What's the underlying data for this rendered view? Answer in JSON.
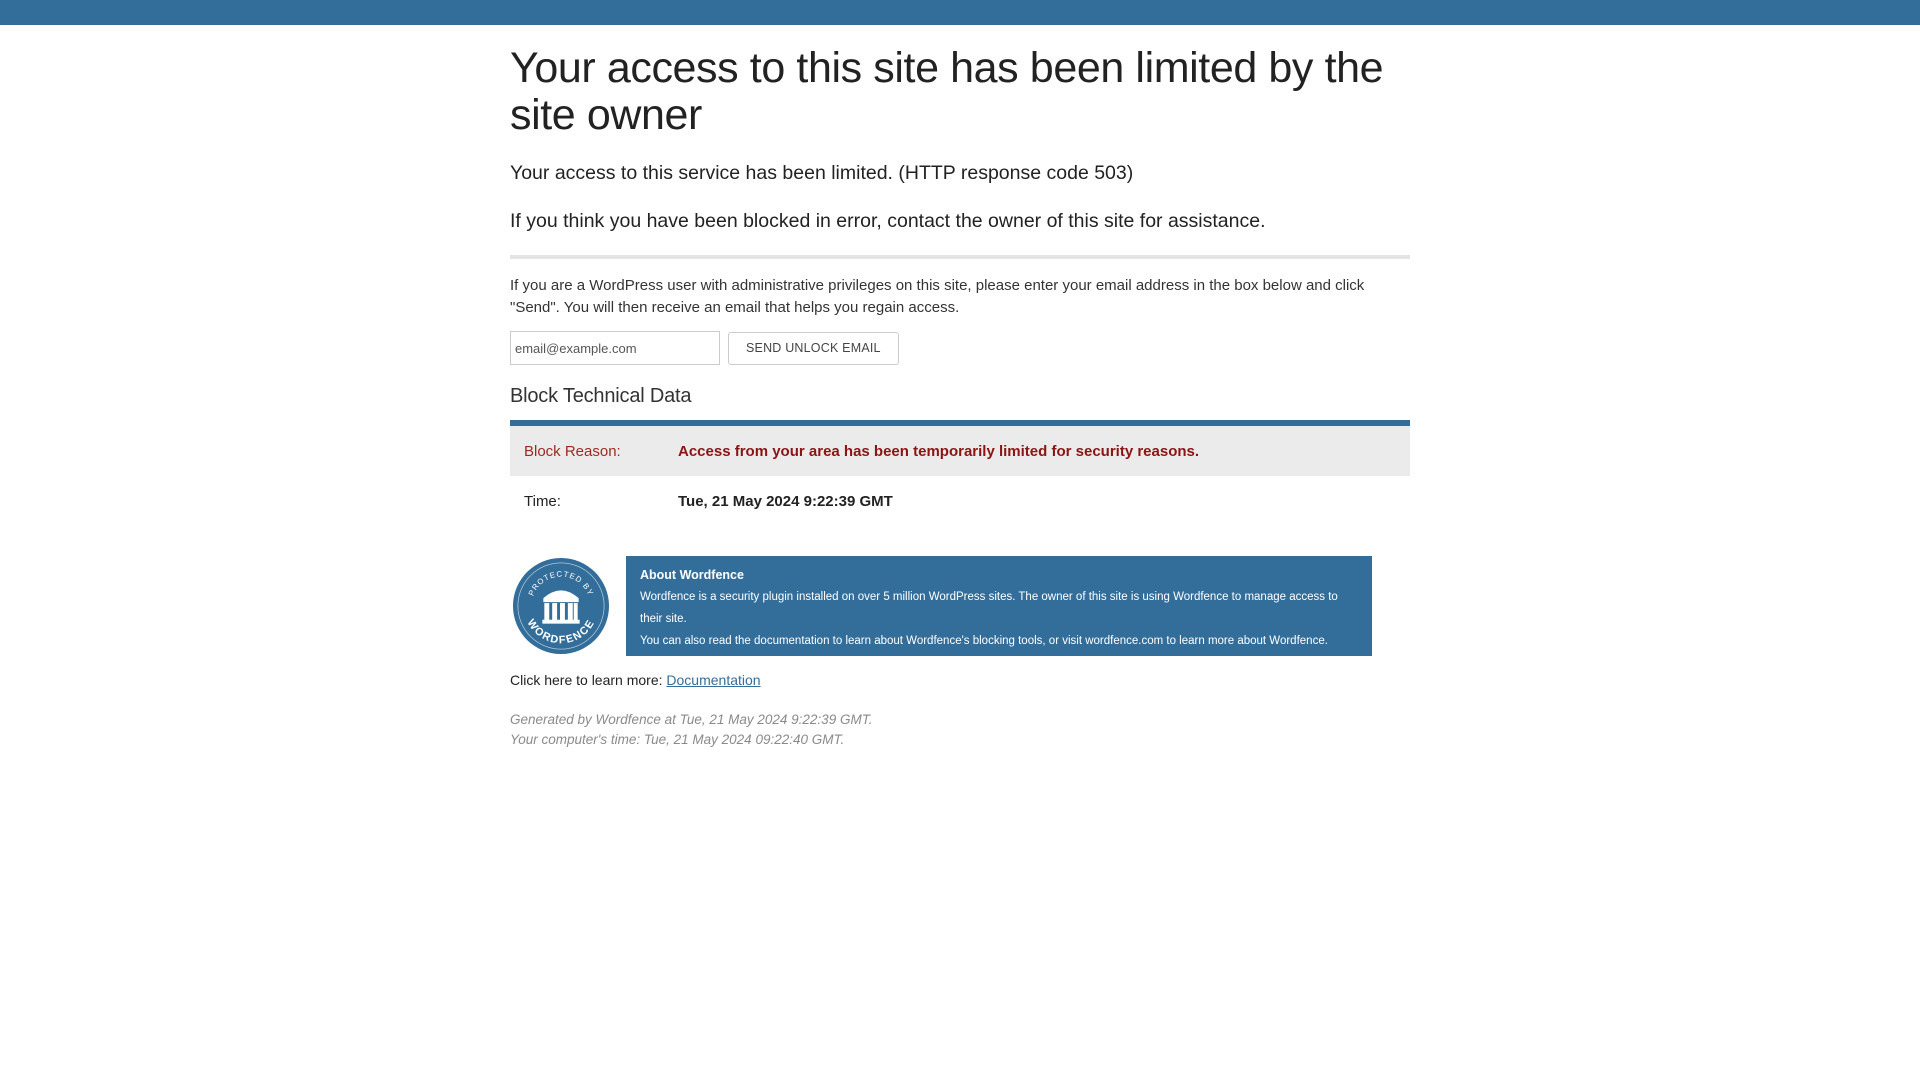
{
  "header": {
    "title": "Your access to this site has been limited by the site owner",
    "lead_1": "Your access to this service has been limited. (HTTP response code 503)",
    "lead_2": "If you think you have been blocked in error, contact the owner of this site for assistance."
  },
  "unlock": {
    "instructions": "If you are a WordPress user with administrative privileges on this site, please enter your email address in the box below and click \"Send\". You will then receive an email that helps you regain access.",
    "email_placeholder": "email@example.com",
    "button_label": "SEND UNLOCK EMAIL"
  },
  "technical": {
    "title": "Block Technical Data",
    "reason_label": "Block Reason:",
    "reason_value": "Access from your area has been temporarily limited for security reasons.",
    "time_label": "Time:",
    "time_value": "Tue, 21 May 2024 9:22:39 GMT"
  },
  "about": {
    "badge_top_text": "PROTECTED BY",
    "badge_bottom_text": "WORDFENCE",
    "title": "About Wordfence",
    "line_1": "Wordfence is a security plugin installed on over 5 million WordPress sites. The owner of this site is using Wordfence to manage access to their site.",
    "line_2": "You can also read the documentation to learn about Wordfence's blocking tools, or visit wordfence.com to learn more about Wordfence."
  },
  "learn_more": {
    "prefix": "Click here to learn more: ",
    "link_label": "Documentation"
  },
  "footer": {
    "generated": "Generated by Wordfence at Tue, 21 May 2024 9:22:39 GMT.",
    "computer_time": "Your computer's time: Tue, 21 May 2024 09:22:40 GMT."
  },
  "colors": {
    "brand_blue": "#336e9b",
    "reason_red": "#8b1414",
    "row_gray": "#ebebeb"
  }
}
